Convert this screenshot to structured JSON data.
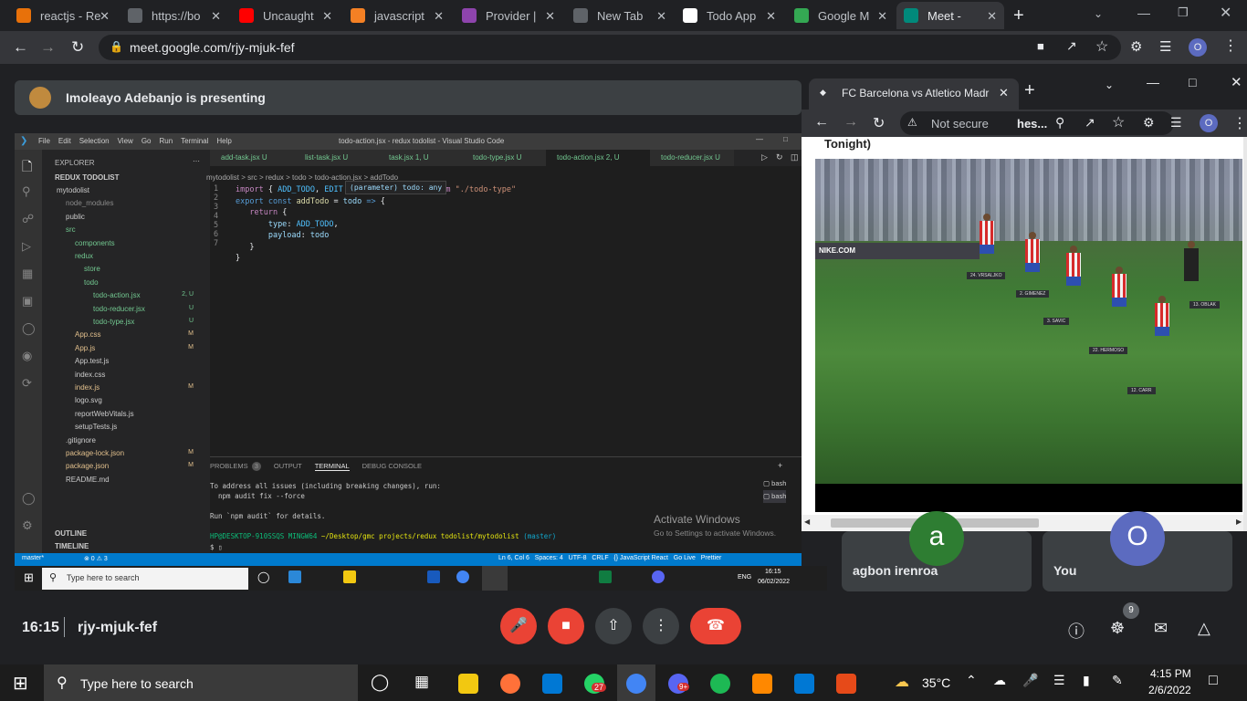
{
  "browser": {
    "tabs": [
      {
        "label": "reactjs - Re",
        "color": "#e8710a"
      },
      {
        "label": "https://bo",
        "color": "#5f6368"
      },
      {
        "label": "Uncaught",
        "color": "#ff0000"
      },
      {
        "label": "javascript",
        "color": "#f48024"
      },
      {
        "label": "Provider |",
        "color": "#8e44ad"
      },
      {
        "label": "New Tab",
        "color": "#5f6368"
      },
      {
        "label": "Todo App",
        "color": "#ffffff"
      },
      {
        "label": "Google M",
        "color": "#34a853"
      },
      {
        "label": "Meet -",
        "color": "#00897b"
      }
    ],
    "new_tab": "+",
    "url": "meet.google.com/rjy-mjuk-fef",
    "profile": "O"
  },
  "meet": {
    "presenter_text": "Imoleayo Adebanjo is presenting",
    "time": "16:15",
    "code": "rjy-mjuk-fef",
    "participants_badge": "9",
    "tiles": [
      {
        "name": "agbon irenroa",
        "initial": "a",
        "color": "#2e7d32"
      },
      {
        "name": "You",
        "initial": "O",
        "color": "#5c6bc0"
      }
    ]
  },
  "vscode": {
    "title": "todo-action.jsx - redux todolist - Visual Studio Code",
    "menu": [
      "File",
      "Edit",
      "Selection",
      "View",
      "Go",
      "Run",
      "Terminal",
      "Help"
    ],
    "explorer_title": "EXPLORER",
    "project": "REDUX TODOLIST",
    "tree": [
      {
        "name": "mytodolist",
        "depth": 1,
        "badge": "",
        "color": "#ccc"
      },
      {
        "name": "node_modules",
        "depth": 2,
        "badge": "",
        "color": "#8b8b8b"
      },
      {
        "name": "public",
        "depth": 2,
        "badge": "",
        "color": "#ccc"
      },
      {
        "name": "src",
        "depth": 2,
        "badge": "",
        "color": "#73c991"
      },
      {
        "name": "components",
        "depth": 3,
        "badge": "",
        "color": "#73c991"
      },
      {
        "name": "redux",
        "depth": 3,
        "badge": "",
        "color": "#73c991"
      },
      {
        "name": "store",
        "depth": 4,
        "badge": "",
        "color": "#73c991"
      },
      {
        "name": "todo",
        "depth": 4,
        "badge": "",
        "color": "#73c991"
      },
      {
        "name": "todo-action.jsx",
        "depth": 5,
        "badge": "2, U",
        "color": "#73c991"
      },
      {
        "name": "todo-reducer.jsx",
        "depth": 5,
        "badge": "U",
        "color": "#73c991"
      },
      {
        "name": "todo-type.jsx",
        "depth": 5,
        "badge": "U",
        "color": "#73c991"
      },
      {
        "name": "App.css",
        "depth": 3,
        "badge": "M",
        "color": "#e2c08d"
      },
      {
        "name": "App.js",
        "depth": 3,
        "badge": "M",
        "color": "#e2c08d"
      },
      {
        "name": "App.test.js",
        "depth": 3,
        "badge": "",
        "color": "#ccc"
      },
      {
        "name": "index.css",
        "depth": 3,
        "badge": "",
        "color": "#ccc"
      },
      {
        "name": "index.js",
        "depth": 3,
        "badge": "M",
        "color": "#e2c08d"
      },
      {
        "name": "logo.svg",
        "depth": 3,
        "badge": "",
        "color": "#ccc"
      },
      {
        "name": "reportWebVitals.js",
        "depth": 3,
        "badge": "",
        "color": "#ccc"
      },
      {
        "name": "setupTests.js",
        "depth": 3,
        "badge": "",
        "color": "#ccc"
      },
      {
        "name": ".gitignore",
        "depth": 2,
        "badge": "",
        "color": "#ccc"
      },
      {
        "name": "package-lock.json",
        "depth": 2,
        "badge": "M",
        "color": "#e2c08d"
      },
      {
        "name": "package.json",
        "depth": 2,
        "badge": "M",
        "color": "#e2c08d"
      },
      {
        "name": "README.md",
        "depth": 2,
        "badge": "",
        "color": "#ccc"
      }
    ],
    "outline": "OUTLINE",
    "timeline": "TIMELINE",
    "editor_tabs": [
      {
        "label": "add-task.jsx U"
      },
      {
        "label": "list-task.jsx U"
      },
      {
        "label": "task.jsx 1, U"
      },
      {
        "label": "todo-type.jsx U"
      },
      {
        "label": "todo-action.jsx 2, U"
      },
      {
        "label": "todo-reducer.jsx U"
      }
    ],
    "breadcrumb": "mytodolist > src > redux > todo > todo-action.jsx > addTodo",
    "hover": "(parameter) todo: any",
    "terminal_tabs": [
      "PROBLEMS",
      "3",
      "OUTPUT",
      "TERMINAL",
      "DEBUG CONSOLE"
    ],
    "terminal_lines": [
      "To address all issues (including breaking changes), run:",
      "  npm audit fix --force",
      "",
      "Run `npm audit` for details."
    ],
    "prompt_user": "HP@DESKTOP-910SSQS MINGW64",
    "prompt_path": "~/Desktop/gmc projects/redux todolist/mytodolist",
    "prompt_branch": "(master)",
    "bash": "bash",
    "activate_title": "Activate Windows",
    "activate_sub": "Go to Settings to activate Windows.",
    "status_left": "master*",
    "status_err": "⊗ 0 ⚠ 3",
    "status_right": "Ln 6, Col 6   Spaces: 4   UTF-8   CRLF   {} JavaScript React   Go Live   Prettier",
    "inner_search": "Type here to search",
    "inner_time": "16:15",
    "inner_date": "06/02/2022",
    "inner_lang": "ENG"
  },
  "popup": {
    "tab_title": "FC Barcelona vs Atletico Madr",
    "not_secure": "Not secure",
    "url": "hes...",
    "page_heading": "Tonight)",
    "player_labels": [
      "24. VRSALJKO",
      "3. SAVIC",
      "2. GIMENEZ",
      "22. HERMOSO",
      "13. OBLAK",
      "12. CARR"
    ],
    "ad_text": "NIKE.COM"
  },
  "taskbar": {
    "search": "Type here to search",
    "temp": "35°C",
    "time": "4:15 PM",
    "date": "2/6/2022",
    "whatsapp_badge": "27",
    "discord_badge": "9+"
  }
}
